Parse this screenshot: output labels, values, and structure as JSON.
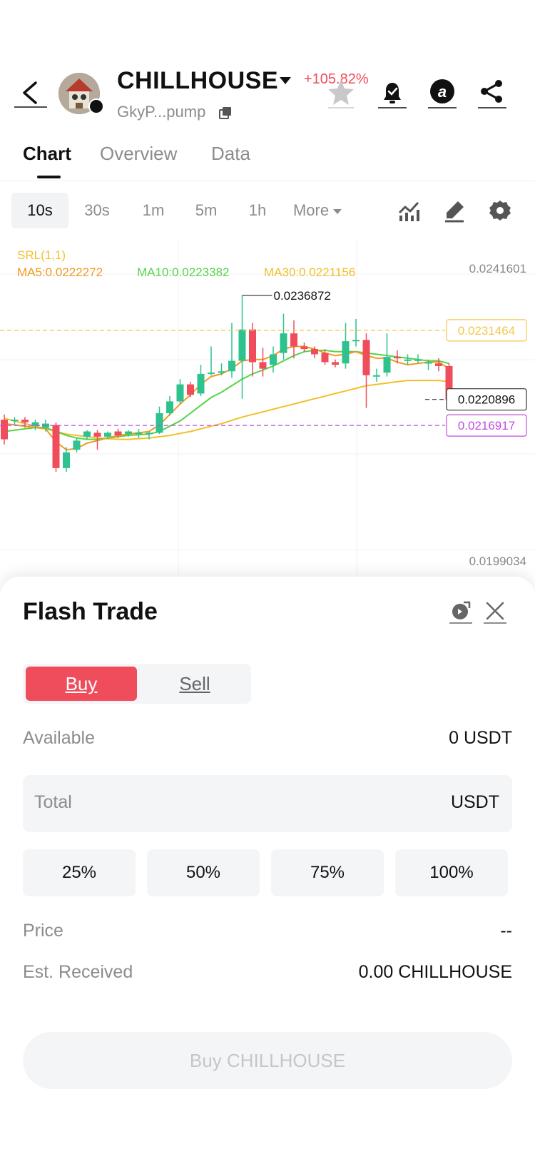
{
  "header": {
    "token_name": "CHILLHOUSE",
    "change": "+105.82%",
    "address": "GkyP...pump",
    "icons": [
      "back-icon",
      "star-icon",
      "bell-icon",
      "at-icon",
      "share-icon"
    ]
  },
  "tabs": [
    {
      "label": "Chart",
      "active": true
    },
    {
      "label": "Overview",
      "active": false
    },
    {
      "label": "Data",
      "active": false
    }
  ],
  "intervals": [
    {
      "label": "10s",
      "active": true
    },
    {
      "label": "30s",
      "active": false
    },
    {
      "label": "1m",
      "active": false
    },
    {
      "label": "5m",
      "active": false
    },
    {
      "label": "1h",
      "active": false
    },
    {
      "label": "More",
      "active": false
    }
  ],
  "chart_tools": [
    "indicator-icon",
    "draw-icon",
    "settings-icon"
  ],
  "chart_data": {
    "type": "candlestick",
    "indicator_label": "SRL(1,1)",
    "ma": [
      {
        "name": "MA5",
        "label": "MA5:0.0222272",
        "color": "#f29a22"
      },
      {
        "name": "MA10",
        "label": "MA10:0.0223382",
        "color": "#55d44a"
      },
      {
        "name": "MA30",
        "label": "MA30:0.0221156",
        "color": "#f2c02c"
      }
    ],
    "y_high_label": "0.0241601",
    "y_low_label": "0.0199034",
    "ylim": [
      0.0199034,
      0.0241601
    ],
    "max_marker": "0.0236872",
    "price_lines": [
      {
        "value": "0.0231464",
        "color": "#f5c64d"
      },
      {
        "value": "0.0220896",
        "color": "#333333"
      },
      {
        "value": "0.0216917",
        "color": "#c14de0"
      }
    ],
    "up_color": "#2ec28e",
    "down_color": "#ef4c5c",
    "candles": [
      [
        0.02178,
        0.02148,
        0.02186,
        0.0214
      ],
      [
        0.02178,
        0.02178,
        0.02182,
        0.0217
      ],
      [
        0.02178,
        0.02174,
        0.02182,
        0.02166
      ],
      [
        0.02168,
        0.02174,
        0.02178,
        0.02162
      ],
      [
        0.02166,
        0.02172,
        0.02178,
        0.0216
      ],
      [
        0.0217,
        0.02104,
        0.02174,
        0.02098
      ],
      [
        0.02104,
        0.02128,
        0.02136,
        0.02098
      ],
      [
        0.02132,
        0.02146,
        0.0215,
        0.02128
      ],
      [
        0.02152,
        0.0216,
        0.02162,
        0.02148
      ],
      [
        0.02158,
        0.02152,
        0.02162,
        0.02132
      ],
      [
        0.02152,
        0.02158,
        0.0216,
        0.02148
      ],
      [
        0.0216,
        0.02154,
        0.02164,
        0.0215
      ],
      [
        0.02156,
        0.0216,
        0.02162,
        0.02152
      ],
      [
        0.02158,
        0.02158,
        0.02164,
        0.0215
      ],
      [
        0.02156,
        0.02158,
        0.0216,
        0.02148
      ],
      [
        0.02158,
        0.02188,
        0.02198,
        0.02156
      ],
      [
        0.02188,
        0.02206,
        0.02214,
        0.02184
      ],
      [
        0.02206,
        0.02232,
        0.0224,
        0.02202
      ],
      [
        0.02232,
        0.02216,
        0.02236,
        0.02212
      ],
      [
        0.02218,
        0.02248,
        0.02262,
        0.02214
      ],
      [
        0.02248,
        0.0225,
        0.0229,
        0.02246
      ],
      [
        0.0225,
        0.02252,
        0.02264,
        0.02246
      ],
      [
        0.02252,
        0.02268,
        0.02326,
        0.02242
      ],
      [
        0.02268,
        0.02316,
        0.02368,
        0.0221
      ],
      [
        0.02316,
        0.02266,
        0.02326,
        0.02244
      ],
      [
        0.02266,
        0.02256,
        0.02288,
        0.02244
      ],
      [
        0.02262,
        0.02278,
        0.0229,
        0.0225
      ],
      [
        0.0228,
        0.0231,
        0.0234,
        0.0227
      ],
      [
        0.0231,
        0.0229,
        0.0233,
        0.02272
      ],
      [
        0.0229,
        0.02286,
        0.02296,
        0.02282
      ],
      [
        0.02286,
        0.02278,
        0.0229,
        0.02272
      ],
      [
        0.0228,
        0.02266,
        0.02286,
        0.02262
      ],
      [
        0.02266,
        0.02262,
        0.0227,
        0.02258
      ],
      [
        0.02264,
        0.02298,
        0.02326,
        0.02256
      ],
      [
        0.02298,
        0.023,
        0.02332,
        0.0229
      ],
      [
        0.023,
        0.02246,
        0.0231,
        0.02196
      ],
      [
        0.02246,
        0.02246,
        0.02256,
        0.02236
      ],
      [
        0.0225,
        0.02274,
        0.0231,
        0.02244
      ],
      [
        0.02274,
        0.02272,
        0.02284,
        0.02264
      ],
      [
        0.0227,
        0.0227,
        0.02278,
        0.02262
      ],
      [
        0.02268,
        0.0227,
        0.02278,
        0.02264
      ],
      [
        0.02264,
        0.02266,
        0.0227,
        0.02254
      ],
      [
        0.02264,
        0.0226,
        0.02272,
        0.02252
      ],
      [
        0.0226,
        0.02208,
        0.02264,
        0.022
      ]
    ],
    "ma5": [
      0.02172,
      0.0217,
      0.02168,
      0.02166,
      0.02164,
      0.02144,
      0.02132,
      0.02134,
      0.02142,
      0.02146,
      0.0215,
      0.02154,
      0.02156,
      0.02158,
      0.0216,
      0.0217,
      0.02186,
      0.02202,
      0.02216,
      0.02232,
      0.02244,
      0.02248,
      0.02256,
      0.02268,
      0.0227,
      0.0227,
      0.02276,
      0.02286,
      0.0229,
      0.0229,
      0.02286,
      0.0228,
      0.02276,
      0.02278,
      0.02282,
      0.02276,
      0.02272,
      0.02272,
      0.02266,
      0.02262,
      0.02264,
      0.02266,
      0.02266,
      0.02256
    ],
    "ma10": [
      0.0216,
      0.02162,
      0.02164,
      0.02166,
      0.02166,
      0.0216,
      0.02154,
      0.0215,
      0.02148,
      0.02148,
      0.0215,
      0.02152,
      0.02154,
      0.02155,
      0.02156,
      0.0216,
      0.02168,
      0.02176,
      0.02188,
      0.022,
      0.02212,
      0.0222,
      0.0223,
      0.0224,
      0.02248,
      0.02254,
      0.0226,
      0.02268,
      0.02276,
      0.02282,
      0.02284,
      0.02284,
      0.02282,
      0.02282,
      0.02282,
      0.0228,
      0.02278,
      0.02276,
      0.02274,
      0.02272,
      0.0227,
      0.02268,
      0.02268,
      0.02264
    ],
    "ma30": [
      0.0218,
      0.02176,
      0.02172,
      0.02168,
      0.02164,
      0.0216,
      0.02156,
      0.02154,
      0.02152,
      0.0215,
      0.02149,
      0.02148,
      0.02148,
      0.02149,
      0.0215,
      0.02152,
      0.02154,
      0.02157,
      0.0216,
      0.02164,
      0.02168,
      0.02172,
      0.02177,
      0.02182,
      0.02186,
      0.0219,
      0.02194,
      0.02198,
      0.02202,
      0.02206,
      0.0221,
      0.02214,
      0.02218,
      0.02222,
      0.02226,
      0.0223,
      0.02232,
      0.02234,
      0.02236,
      0.02238,
      0.02238,
      0.02238,
      0.02238,
      0.02236
    ]
  },
  "flash_trade": {
    "title": "Flash Trade",
    "buy_label": "Buy",
    "sell_label": "Sell",
    "available_label": "Available",
    "available_value": "0 USDT",
    "total_label": "Total",
    "total_unit": "USDT",
    "percent_options": [
      "25%",
      "50%",
      "75%",
      "100%"
    ],
    "price_label": "Price",
    "price_value": "--",
    "est_label": "Est. Received",
    "est_value": "0.00 CHILLHOUSE",
    "cta_label": "Buy CHILLHOUSE",
    "icons": [
      "refresh-settings-icon",
      "close-icon"
    ]
  }
}
